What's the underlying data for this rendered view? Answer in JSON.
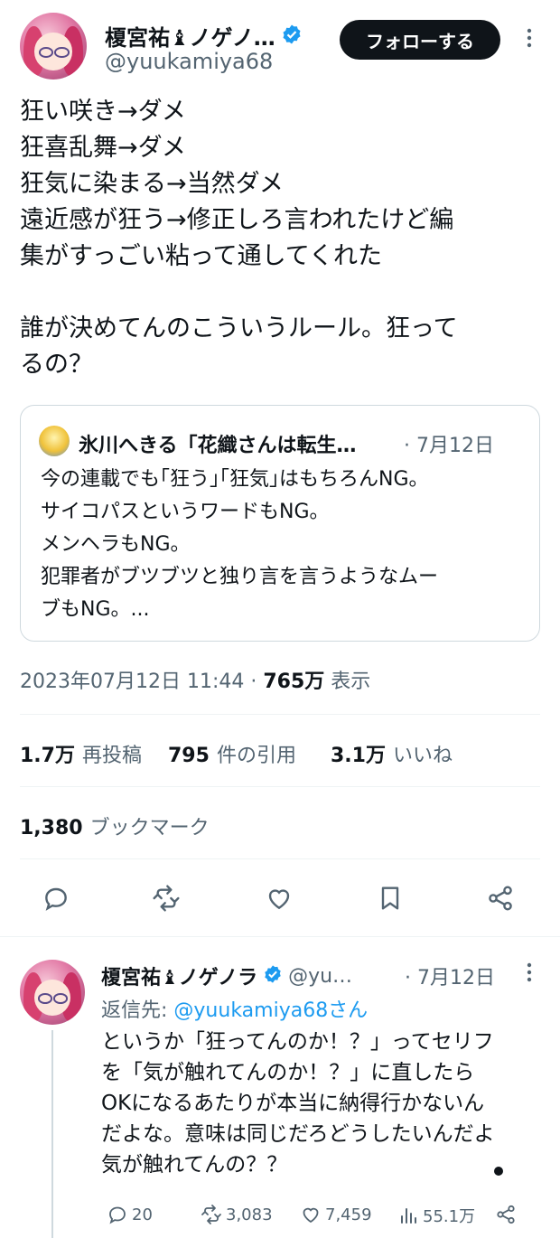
{
  "tweet": {
    "author_name": "榎宮祐♝ノゲノ…",
    "author_handle": "@yuukamiya68",
    "follow_label": "フォローする",
    "more_icon": "more-vertical-icon",
    "body": "狂い咲き→ダメ\n狂喜乱舞→ダメ\n狂気に染まる→当然ダメ\n遠近感が狂う→修正しろ言われたけど編\n集がすっごい粘って通してくれた\n\n誰が決めてんのこういうルール。狂って\nるの？",
    "quote": {
      "author_name": "氷川へきる「花織さんは転生…",
      "date": "· 7月12日",
      "body": "今の連載でも｢狂う｣｢狂気｣はもちろんNG。\nサイコパスというワードもNG。\nメンヘラもNG。\n犯罪者がブツブツと独り言を言うようなムー\nブもNG。..."
    },
    "datetime": "2023年07月12日 11:44 · ",
    "views_value": "765万",
    "views_label": " 表示",
    "stats": {
      "reposts_value": "1.7万",
      "reposts_label": "再投稿",
      "quotes_value": "795",
      "quotes_label": "件の引用",
      "likes_value": "3.1万",
      "likes_label": "いいね",
      "bookmarks_value": "1,380",
      "bookmarks_label": "ブックマーク"
    },
    "colors": {
      "verified": "#1d9bf0",
      "text": "#0f1419",
      "secondary": "#536471",
      "divider": "#eff3f4"
    }
  },
  "reply": {
    "author_name": "榎宮祐♝ノゲノラ",
    "author_handle": "@yu…",
    "date": "· 7月12日",
    "reply_to_label": "返信先: ",
    "reply_to_handle": "@yuukamiya68さん",
    "body": "というか「狂ってんのか！？」ってセリフ\nを「気が触れてんのか！？」に直したら\nOKになるあたりが本当に納得行かないん\nだよな。意味は同じだろどうしたいんだよ\n気が触れてんの？？",
    "replies": "20",
    "reposts": "3,083",
    "likes": "7,459",
    "views": "55.1万"
  }
}
